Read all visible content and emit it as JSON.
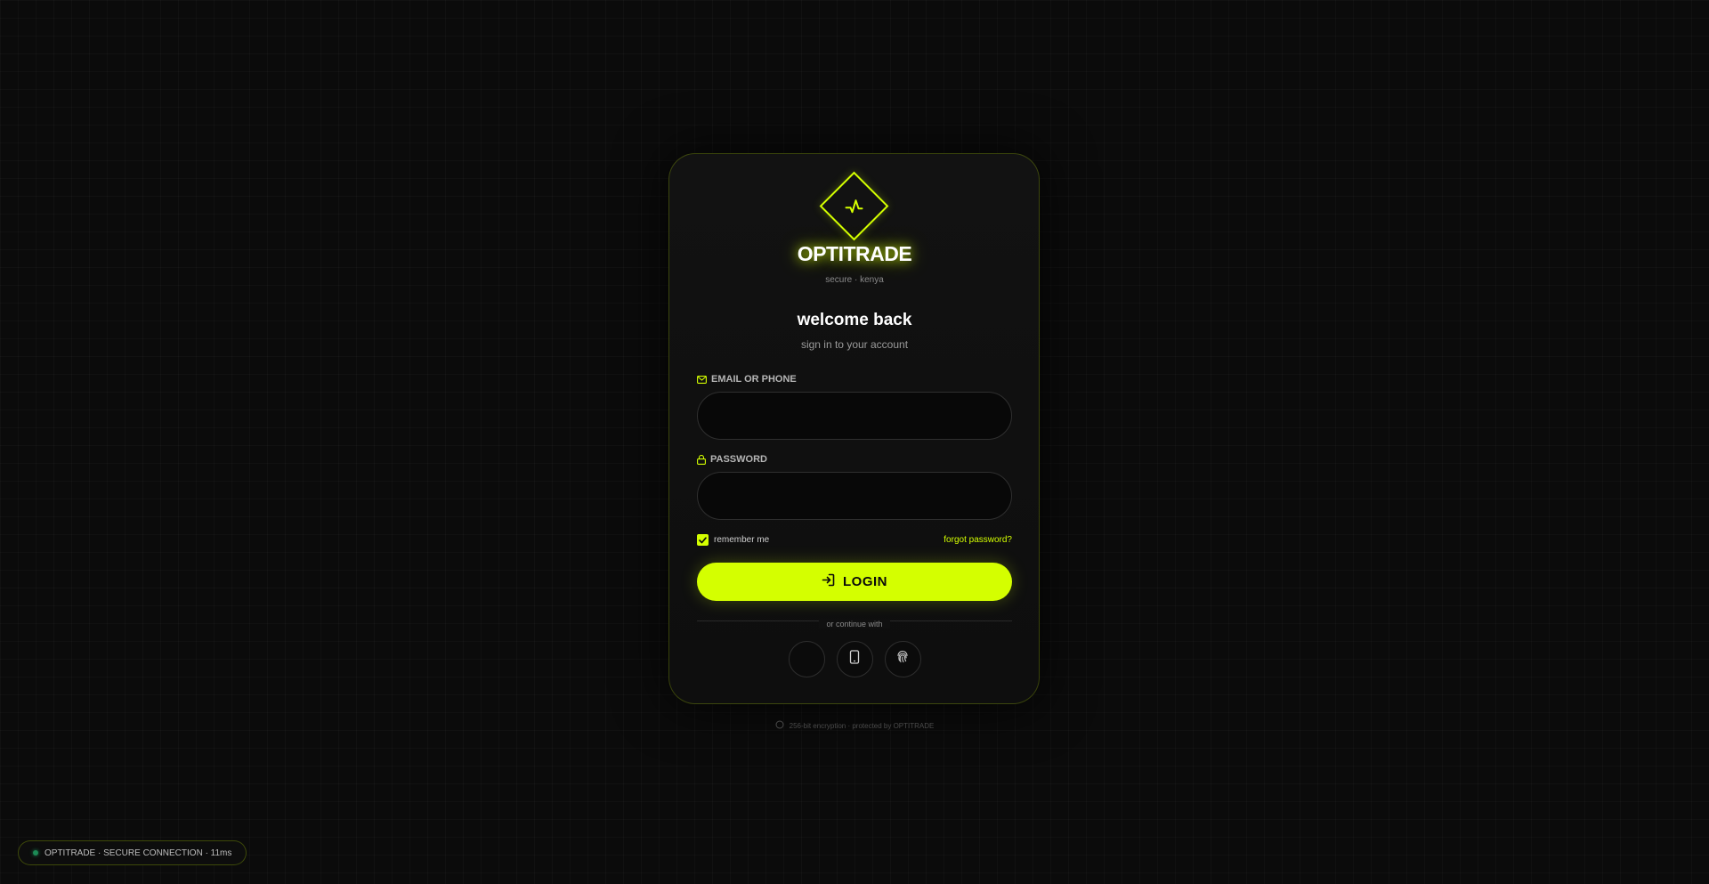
{
  "brand": {
    "name": "OPTITRADE",
    "tagline": "secure · kenya",
    "accent_color": "#d4ff00"
  },
  "heading": {
    "title": "welcome back",
    "subtitle": "sign in to your account"
  },
  "form": {
    "email_label": "EMAIL OR PHONE",
    "email_value": "",
    "password_label": "PASSWORD",
    "password_value": "",
    "remember_label": "remember me",
    "remember_checked": true,
    "forgot_label": "forgot password?",
    "login_label": "LOGIN"
  },
  "alternatives": {
    "divider_text": "or continue with",
    "options": [
      "blank-icon",
      "phone-icon",
      "fingerprint-icon"
    ]
  },
  "footer": {
    "note": "256-bit encryption · protected by OPTITRADE"
  },
  "status": {
    "text": "OPTITRADE · SECURE CONNECTION · 11ms"
  }
}
